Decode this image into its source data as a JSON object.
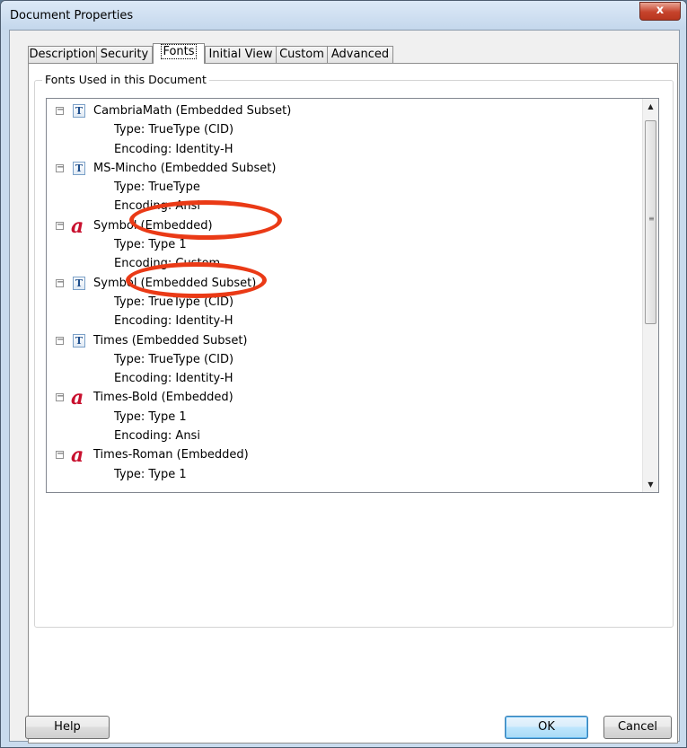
{
  "window": {
    "title": "Document Properties",
    "close_label": "x"
  },
  "tabs": [
    {
      "label": "Description",
      "active": false
    },
    {
      "label": "Security",
      "active": false
    },
    {
      "label": "Fonts",
      "active": true
    },
    {
      "label": "Initial View",
      "active": false
    },
    {
      "label": "Custom",
      "active": false
    },
    {
      "label": "Advanced",
      "active": false
    }
  ],
  "fonts_group": {
    "label": "Fonts Used in this Document",
    "fonts": [
      {
        "name": "CambriaMath (Embedded Subset)",
        "icon": "truetype-font-icon",
        "type": "Type: TrueType (CID)",
        "encoding": "Encoding: Identity-H"
      },
      {
        "name": "MS-Mincho (Embedded Subset)",
        "icon": "truetype-font-icon",
        "type": "Type: TrueType",
        "encoding": "Encoding: Ansi"
      },
      {
        "name": "Symbol (Embedded)",
        "icon": "type1-font-icon",
        "type": "Type: Type 1",
        "encoding": "Encoding: Custom"
      },
      {
        "name": "Symbol (Embedded Subset)",
        "icon": "truetype-font-icon",
        "type": "Type: TrueType (CID)",
        "encoding": "Encoding: Identity-H"
      },
      {
        "name": "Times (Embedded Subset)",
        "icon": "truetype-font-icon",
        "type": "Type: TrueType (CID)",
        "encoding": "Encoding: Identity-H"
      },
      {
        "name": "Times-Bold (Embedded)",
        "icon": "type1-font-icon",
        "type": "Type: Type 1",
        "encoding": "Encoding: Ansi"
      },
      {
        "name": "Times-Roman (Embedded)",
        "icon": "type1-font-icon",
        "type": "Type: Type 1",
        "encoding": null
      }
    ],
    "expander_glyph": "−",
    "truetype_glyph": "T",
    "type1_glyph": "a"
  },
  "scrollbar": {
    "up_glyph": "▲",
    "down_glyph": "▼",
    "grip_glyph": "≡"
  },
  "buttons": {
    "help": "Help",
    "ok": "OK",
    "cancel": "Cancel"
  },
  "colors": {
    "annotation": "#ea3a16",
    "type1_icon": "#c8102e",
    "truetype_icon": "#1f4f8c"
  }
}
